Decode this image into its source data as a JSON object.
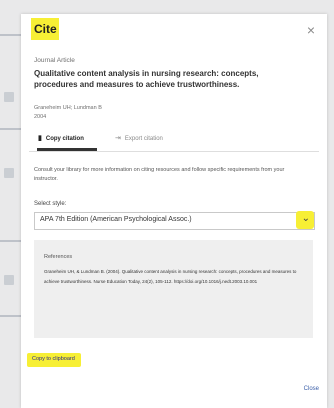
{
  "dialog": {
    "title": "Cite",
    "close_glyph": "×",
    "close_label": "Close"
  },
  "article": {
    "type": "Journal Article",
    "title": "Qualitative content analysis in nursing research: concepts, procedures and measures to achieve trustworthiness.",
    "authors": "Graneheim UH; Lundman B",
    "year": "2004"
  },
  "tabs": [
    {
      "label": "Copy citation",
      "icon": "clipboard-icon",
      "active": true
    },
    {
      "label": "Export citation",
      "icon": "export-icon",
      "active": false
    }
  ],
  "consult_text": "Consult your library for more information on citing resources and follow specific requirements from your instructor.",
  "select_style": {
    "label": "Select style:",
    "value": "APA 7th Edition (American Psychological Assoc.)"
  },
  "references": {
    "label": "References",
    "text": "Graneheim UH, & Lundman B. (2004). Qualitative content analysis in nursing research: concepts, procedures and measures to achieve trustworthiness. Nurse Education Today, 24(2), 105-112. https://doi.org/10.1016/j.nedt.2003.10.001"
  },
  "copy_to_clipboard": "Copy to clipboard",
  "colors": {
    "highlight": "#f7ef35",
    "link": "#3a5ea8"
  }
}
